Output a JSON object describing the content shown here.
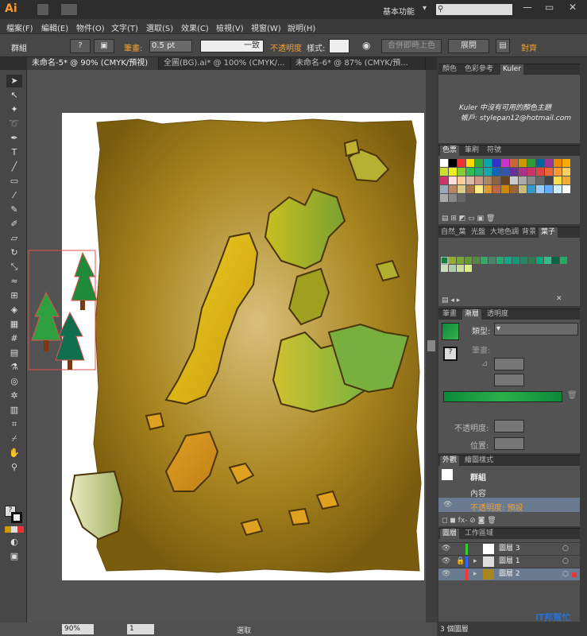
{
  "app": {
    "logo": "Ai",
    "workspace": "基本功能",
    "search_placeholder": ""
  },
  "menu": [
    "檔案(F)",
    "編輯(E)",
    "物件(O)",
    "文字(T)",
    "選取(S)",
    "效果(C)",
    "檢視(V)",
    "視窗(W)",
    "說明(H)"
  ],
  "control": {
    "selection": "群組",
    "stroke_label": "筆畫:",
    "stroke_value": "0.5 pt",
    "profile": "一致",
    "opacity_label": "不透明度",
    "style_label": "樣式:",
    "merge_button": "合併即時上色",
    "expand_button": "展開",
    "align_label": "對齊"
  },
  "tabs": [
    "未命名-5* @ 90% (CMYK/預視)",
    "全圖(BG).ai* @ 100% (CMYK/...",
    "未命名-6* @ 87% (CMYK/預..."
  ],
  "panels": {
    "color_tabs": [
      "顏色",
      "色彩參考",
      "Kuler"
    ],
    "kuler_msg": "Kuler 中沒有可用的顏色主題",
    "kuler_account": "帳戶: stylepan12@hotmail.com",
    "swatch_tabs": [
      "色票",
      "筆刷",
      "符號"
    ],
    "lib_tabs": [
      "自然_葉",
      "光盤",
      "大地色調",
      "背景",
      "葉子"
    ],
    "stroke_tabs": [
      "筆畫",
      "漸層",
      "透明度"
    ],
    "gradient": {
      "type_label": "類型:",
      "stroke_label": "筆畫:",
      "opacity_label": "不透明度:",
      "position_label": "位置:"
    },
    "appearance_tabs": [
      "外觀",
      "繪圖樣式"
    ],
    "appearance": {
      "title": "群組",
      "content": "內容",
      "opacity": "不透明度: 預設"
    },
    "layer_tabs": [
      "圖層",
      "工作區域"
    ],
    "layers": [
      {
        "name": "圖層 3",
        "color": "#33cc33"
      },
      {
        "name": "圖層 1",
        "color": "#3366ff"
      },
      {
        "name": "圖層 2",
        "color": "#ff3333"
      }
    ],
    "layer_count": "3 個圖層"
  },
  "status": {
    "zoom": "90%",
    "page": "1",
    "tool": "選取"
  },
  "watermark": "iT邦幫忙"
}
